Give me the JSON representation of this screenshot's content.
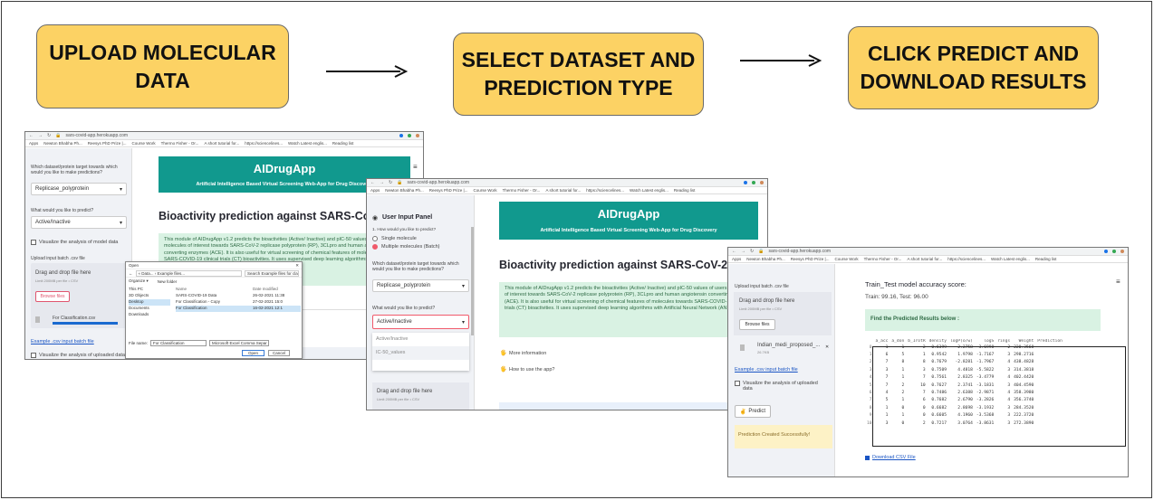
{
  "steps": [
    {
      "label_line1": "UPLOAD MOLECULAR",
      "label_line2": "DATA"
    },
    {
      "label_line1": "SELECT DATASET AND",
      "label_line2": "PREDICTION TYPE"
    },
    {
      "label_line1": "CLICK PREDICT AND",
      "label_line2": "DOWNLOAD RESULTS"
    }
  ],
  "browser": {
    "url": "sars-covid-app.herokuapp.com",
    "bookmarks": [
      "Apps",
      "Newton Bhabha Ph...",
      "Reesys PhD Prize |...",
      "Course Work",
      "Thermo Fisher - Or...",
      "A short tutorial for...",
      "https://sciencelines...",
      "Watch Latest englis...",
      "Reading list"
    ]
  },
  "app": {
    "title": "AIDrugApp",
    "subtitle": "Artificial Intelligence Based Virtual Screening Web-App for Drug Discovery",
    "heading": "Bioactivity prediction against SARS-CoV-2",
    "description": "This module of AIDrugApp v1.2 predicts the bioactivities (Active/ Inactive) and pIC-50 values of users molecules of interest towards SARS-CoV-2 replicase polyprotein (RP), 3CLpro and human angiotensin converting enzymes (ACE). It is also useful for virtual screening of chemical features of molecules towards SARS-COVID-19 clinical trials (CT) bioactivities. It uses supervised deep learning algorithms with Artificial Neural Network (ANN).",
    "target_question": "Which dataset/protein target towards which would you like to make predictions?",
    "target_value": "Replicase_polyprotein",
    "predict_question": "What would you like to predict?",
    "predict_value": "Active/Inactive",
    "predict_options": [
      "Active/Inactive",
      "IC-50_values"
    ],
    "visualize_label": "Visualize the analysis of model data",
    "visualize_uploaded": "Visualize the analysis of uploaded data",
    "upload_label": "Upload input batch .csv file",
    "drag_drop": "Drag and drop file here",
    "limit": "Limit 200MB per file • CSV",
    "browse": "Browse files",
    "example_link": "Example .csv input batch file",
    "user_input_panel": "User Input Panel",
    "how_input": "1. How would you like to predict?",
    "single": "Single molecule",
    "multiple": "Multiple molecules (Batch)",
    "more_info": "More information",
    "how_to_use": "How to use the app?",
    "uploaded_file": "For Classification.csv",
    "uploaded_file2": "Indian_medi_proposed_...",
    "uploaded_size": "26.7KB",
    "predict_btn": "Predict",
    "success": "Prediction Created Successfully!",
    "accuracy_title": "Train_Test model accuracy score:",
    "accuracy_values": "Train: 99.16, Test: 96.00",
    "find_results": "Find the Predicted Results below :",
    "download": "Download CSV File"
  },
  "file_dialog": {
    "title": "Open",
    "path": "« Data... › Example files...",
    "search": "Search Example files for classi...",
    "organize": "Organize ▾",
    "new_folder": "New folder",
    "col_name": "Name",
    "col_date": "Date modified",
    "nav": [
      "This PC",
      "3D Objects",
      "Desktop",
      "Documents",
      "Downloads"
    ],
    "files": [
      {
        "name": "SARS-COVID-19 Data",
        "date": "26-02-2021 11:38"
      },
      {
        "name": "For Classification - Copy",
        "date": "27-02-2021 15:0"
      },
      {
        "name": "For Classification",
        "date": "16-02-2021 12:1"
      }
    ],
    "file_name_label": "File name:",
    "file_name": "For Classification",
    "file_type": "Microsoft Excel Comma Separ",
    "open": "Open",
    "cancel": "Cancel"
  },
  "results_table": {
    "columns": [
      "",
      "a_acc",
      "a_don",
      "b_1rotR",
      "density",
      "logP(o/w)",
      "logS",
      "rings",
      "Weight",
      "Prediction"
    ],
    "rows": [
      [
        "0",
        "1",
        "1",
        "2",
        "0.6399",
        "2.2758",
        "-3.6998",
        "2",
        "220.3568",
        ""
      ],
      [
        "1",
        "6",
        "5",
        "1",
        "0.9542",
        "1.9798",
        "-1.7167",
        "3",
        "298.2716",
        ""
      ],
      [
        "2",
        "7",
        "8",
        "8",
        "0.7679",
        "-2.8281",
        "-1.7967",
        "4",
        "438.4828",
        ""
      ],
      [
        "3",
        "3",
        "1",
        "3",
        "0.7509",
        "4.4818",
        "-5.5822",
        "3",
        "314.3818",
        ""
      ],
      [
        "4",
        "7",
        "1",
        "7",
        "0.7561",
        "2.8325",
        "-3.4779",
        "4",
        "402.4420",
        ""
      ],
      [
        "5",
        "7",
        "2",
        "10",
        "0.7627",
        "2.3741",
        "-3.1831",
        "3",
        "404.4590",
        ""
      ],
      [
        "6",
        "4",
        "2",
        "7",
        "0.7486",
        "2.6388",
        "-2.9871",
        "4",
        "358.3980",
        ""
      ],
      [
        "7",
        "5",
        "1",
        "6",
        "0.7682",
        "2.6790",
        "-3.2826",
        "4",
        "356.3740",
        ""
      ],
      [
        "8",
        "1",
        "0",
        "0",
        "0.6682",
        "2.8698",
        "-3.1932",
        "3",
        "284.3520",
        ""
      ],
      [
        "9",
        "1",
        "1",
        "0",
        "0.6605",
        "4.1960",
        "-3.5368",
        "3",
        "222.3720",
        ""
      ],
      [
        "10",
        "3",
        "0",
        "2",
        "0.7217",
        "3.0764",
        "-3.8631",
        "3",
        "272.3890",
        ""
      ]
    ]
  }
}
